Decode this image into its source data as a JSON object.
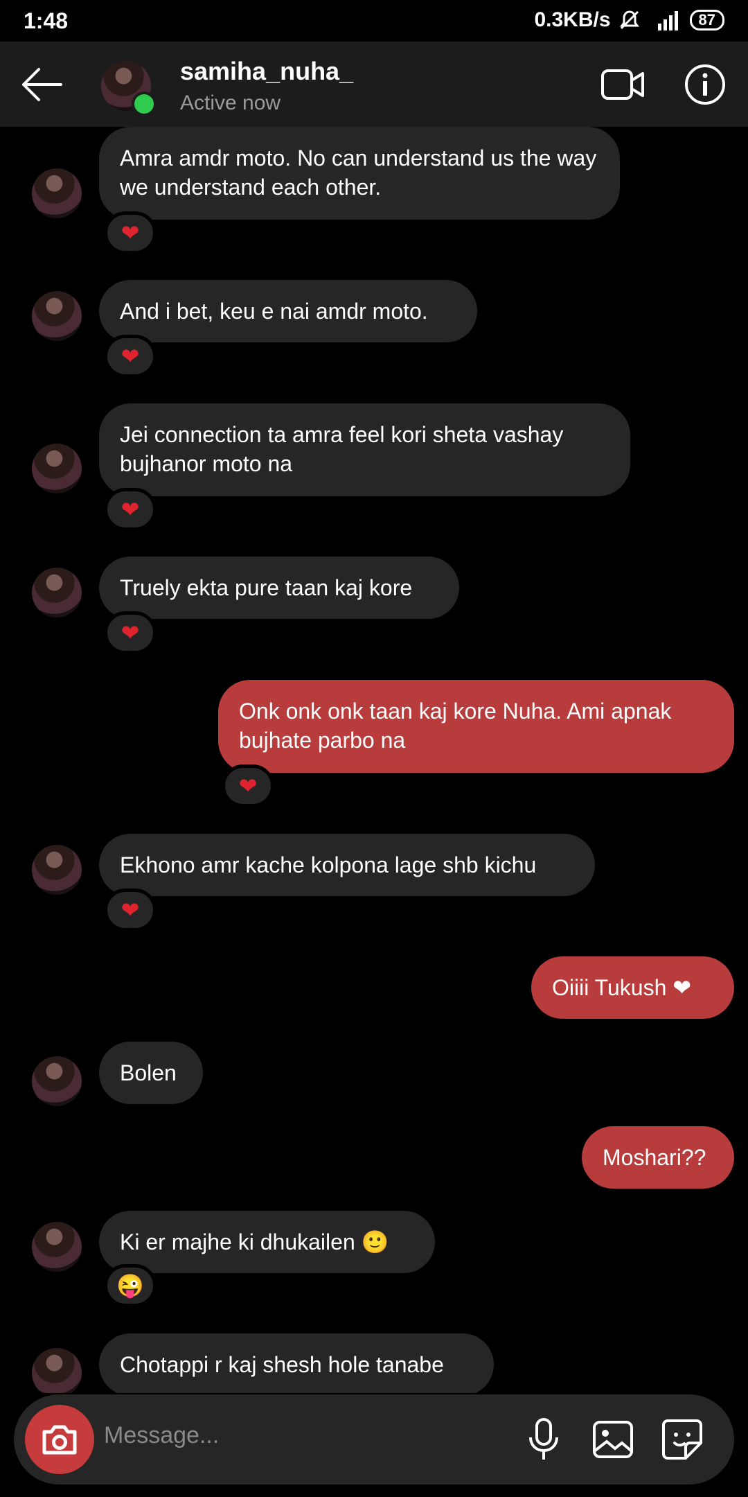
{
  "status_bar": {
    "time": "1:48",
    "speed": "0.3KB/s",
    "battery": "87"
  },
  "header": {
    "username": "samiha_nuha_",
    "status": "Active now"
  },
  "messages": [
    {
      "side": "in",
      "text": "Amra amdr moto. No can understand us the way we understand each other.",
      "reaction": "❤"
    },
    {
      "side": "in",
      "text": "And i bet, keu e nai amdr moto.",
      "reaction": "❤"
    },
    {
      "side": "in",
      "text": "Jei connection ta amra feel kori sheta vashay bujhanor moto na",
      "reaction": "❤"
    },
    {
      "side": "in",
      "text": "Truely ekta pure taan kaj kore",
      "reaction": "❤"
    },
    {
      "side": "out",
      "text": "Onk onk onk taan kaj kore Nuha. Ami apnak bujhate parbo na",
      "reaction": "❤"
    },
    {
      "side": "in",
      "text": "Ekhono amr kache kolpona lage shb kichu",
      "reaction": "❤"
    },
    {
      "side": "out",
      "text": "Oiiii Tukush ❤"
    },
    {
      "side": "in",
      "text": "Bolen"
    },
    {
      "side": "out",
      "text": "Moshari??"
    },
    {
      "side": "in",
      "text": "Ki er majhe ki dhukailen 🙂",
      "reaction": "😜"
    },
    {
      "side": "in",
      "text": "Chotappi r kaj shesh hole tanabe"
    }
  ],
  "composer": {
    "placeholder": "Message..."
  },
  "colors": {
    "incoming_bubble": "#262626",
    "outgoing_bubble": "#b83c3c",
    "online_dot": "#2fcc4f"
  }
}
